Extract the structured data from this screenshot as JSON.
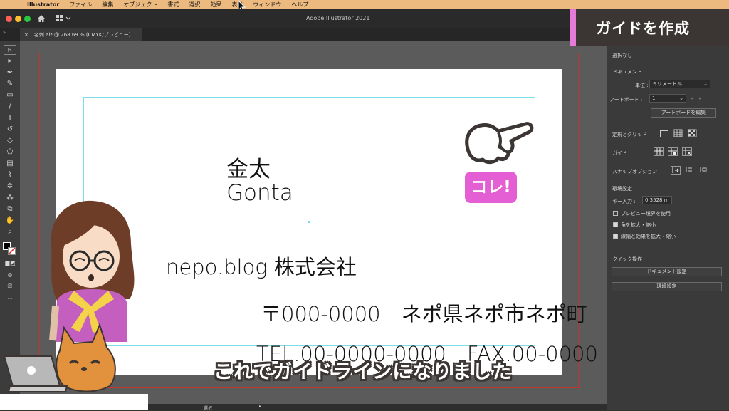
{
  "menubar": {
    "items": [
      "Illustrator",
      "ファイル",
      "編集",
      "オブジェクト",
      "書式",
      "選択",
      "効果",
      "表示",
      "ウィンドウ",
      "ヘルプ"
    ]
  },
  "window": {
    "title": "Adobe Illustrator 2021",
    "doc_tab": "名刺.ai* @ 268.69 % (CMYK/プレビュー)"
  },
  "header": {
    "title": "ガイドを作成"
  },
  "card": {
    "name_jp": "金太",
    "name_en": "Gonta",
    "company": "nepo.blog 株式会社",
    "address": "〒000-0000　ネポ県ネポ市ネポ町",
    "tel": "TEL.00-0000-0000　FAX.00-0000"
  },
  "badge": {
    "label": "コレ!"
  },
  "subtitle": "これでガイドラインになりました",
  "panel": {
    "no_selection": "選択なし",
    "document": "ドキュメント",
    "unit_label": "単位 :",
    "unit_value": "ミリメートル",
    "artboard_label": "アートボード :",
    "artboard_value": "1",
    "edit_artboard": "アートボードを編集",
    "ruler_grid": "定規とグリッド",
    "guides": "ガイド",
    "snap_options": "スナップオプション",
    "preferences": "環境設定",
    "key_input_label": "キー入力 :",
    "key_input_value": "0.3528 m",
    "preview_bounds": "プレビュー境界を使用",
    "scale_corners": "角を拡大・縮小",
    "scale_strokes": "線幅と効果を拡大・縮小",
    "quick_actions": "クイック操作",
    "doc_settings": "ドキュメント設定",
    "prefs_button": "環境設定"
  },
  "status": {
    "tool": "選択"
  },
  "colors": {
    "menubar": "#ecb97f",
    "accent_pink": "#e35fd3",
    "header_bg": "#3b3633",
    "guide": "#7fdde7",
    "bleed": "#c2362b"
  }
}
